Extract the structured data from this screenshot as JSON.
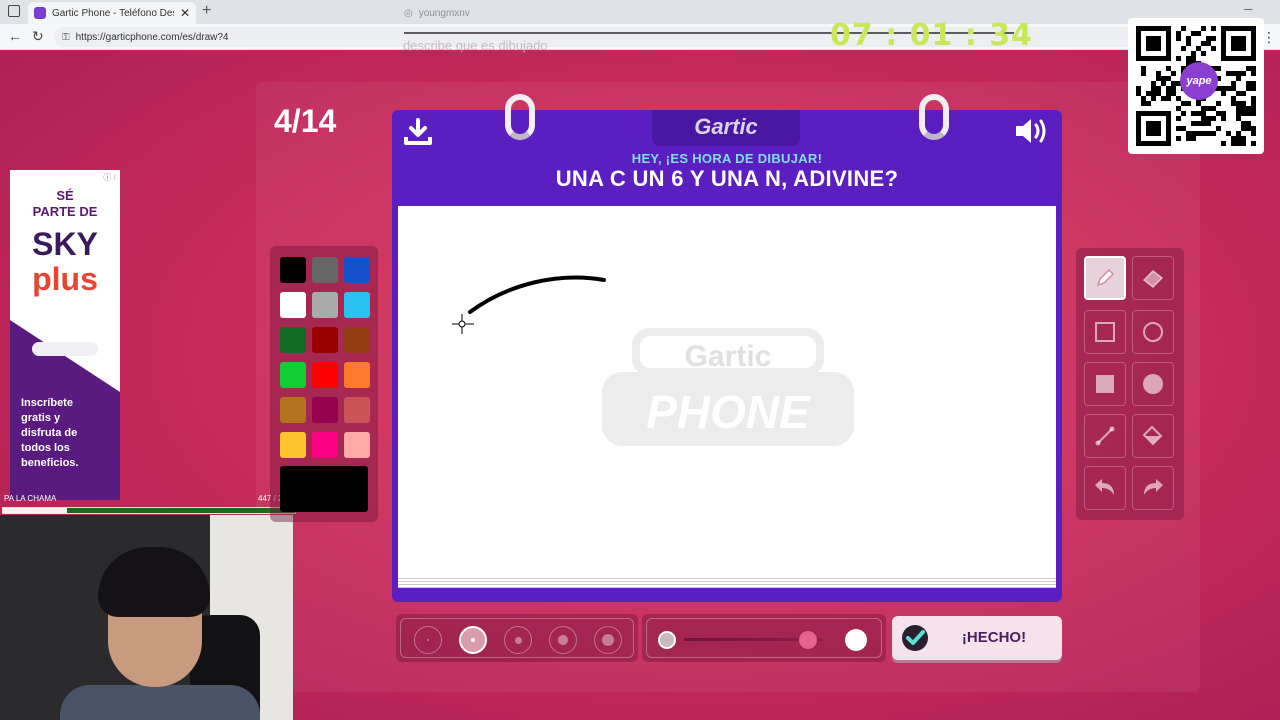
{
  "browser": {
    "tab_title": "Gartic Phone - Teléfono Descomp",
    "tab_close": "✕",
    "new_tab": "+",
    "url": "https://garticphone.com/es/draw?4",
    "profile": "youngmxnv"
  },
  "overlay": {
    "caption": "describe que es dibujado",
    "timer": "07 : 01 : 34"
  },
  "game": {
    "round": "4/14",
    "logo": "Gartic",
    "heading_small": "HEY, ¡ES HORA DE DIBUJAR!",
    "heading_big": "UNA C UN 6 Y UNA N, ADIVINE?",
    "done_label": "¡HECHO!",
    "watermark": [
      "Gartic",
      "PHONE"
    ]
  },
  "palette": {
    "colors": [
      "#000000",
      "#666666",
      "#1551cc",
      "#ffffff",
      "#aaaaaa",
      "#29c2f0",
      "#116b25",
      "#990000",
      "#923c12",
      "#11cc33",
      "#ff0000",
      "#ff7a2e",
      "#b1731e",
      "#96004e",
      "#cb5459",
      "#ffc42e",
      "#ff0082",
      "#fea9a5"
    ],
    "selected": "#000000"
  },
  "tools": {
    "items": [
      "pencil-icon",
      "eraser-icon",
      "square-outline-icon",
      "circle-outline-icon",
      "square-filled-icon",
      "circle-filled-icon",
      "line-icon",
      "fill-bucket-icon",
      "undo-icon",
      "redo-icon"
    ],
    "active": "pencil-icon"
  },
  "brush": {
    "sizes": 5,
    "selected_index": 1,
    "opacity_percent": 90
  },
  "ad": {
    "line1": "SÉ",
    "line2": "PARTE DE",
    "brand1": "SKY",
    "brand2": "plus",
    "body": [
      "Inscríbete",
      "gratis y",
      "disfruta de",
      "todos los",
      "beneficios."
    ],
    "info": "ⓘ ⁝"
  },
  "stream": {
    "label": "PA LA CHAMA",
    "count": "447 / 2000",
    "progress": 0.22
  },
  "qr": {
    "badge": "yape"
  }
}
